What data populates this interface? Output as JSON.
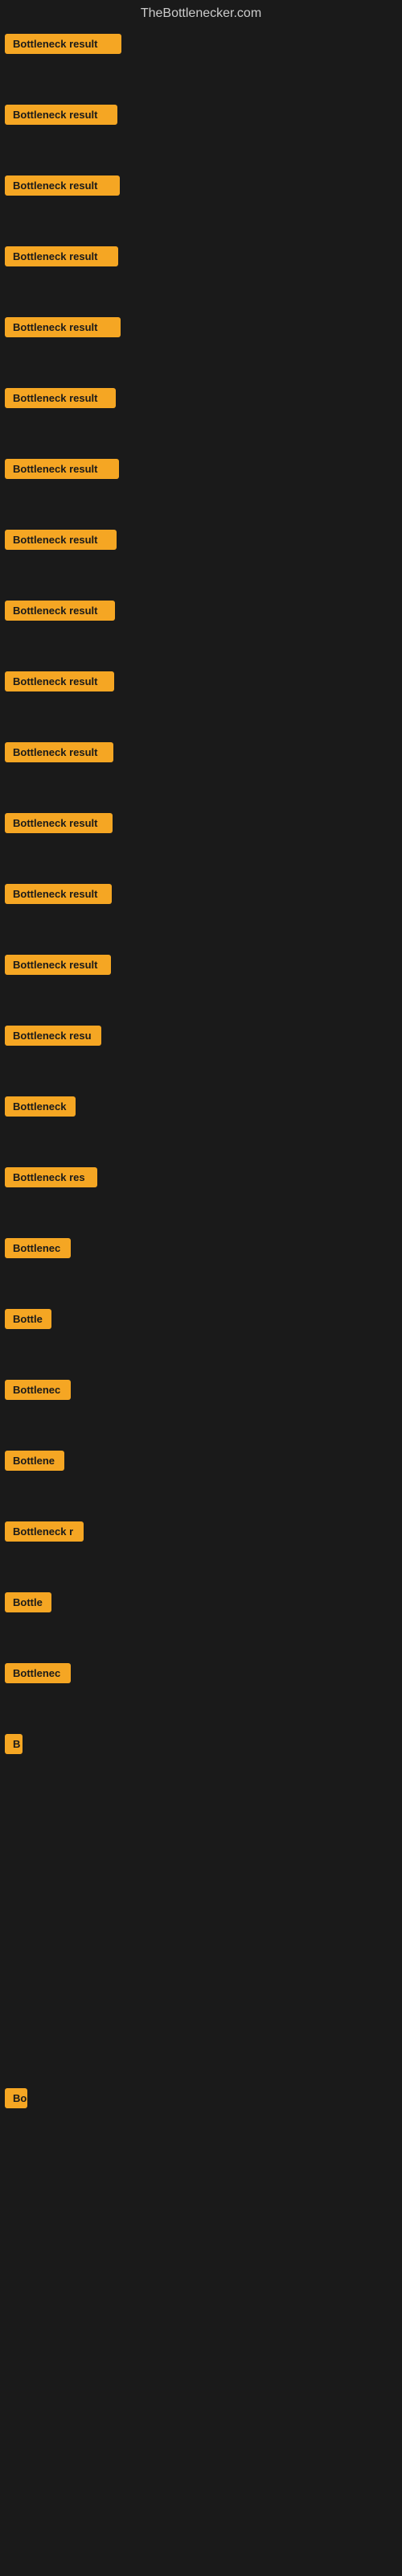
{
  "header": {
    "title": "TheBottlenecker.com"
  },
  "items": [
    {
      "label": "Bottleneck result",
      "badge_width": 145
    },
    {
      "label": "Bottleneck result",
      "badge_width": 140
    },
    {
      "label": "Bottleneck result",
      "badge_width": 143
    },
    {
      "label": "Bottleneck result",
      "badge_width": 141
    },
    {
      "label": "Bottleneck result",
      "badge_width": 144
    },
    {
      "label": "Bottleneck result",
      "badge_width": 138
    },
    {
      "label": "Bottleneck result",
      "badge_width": 142
    },
    {
      "label": "Bottleneck result",
      "badge_width": 139
    },
    {
      "label": "Bottleneck result",
      "badge_width": 137
    },
    {
      "label": "Bottleneck result",
      "badge_width": 136
    },
    {
      "label": "Bottleneck result",
      "badge_width": 135
    },
    {
      "label": "Bottleneck result",
      "badge_width": 134
    },
    {
      "label": "Bottleneck result",
      "badge_width": 133
    },
    {
      "label": "Bottleneck result",
      "badge_width": 132
    },
    {
      "label": "Bottleneck resu",
      "badge_width": 120
    },
    {
      "label": "Bottleneck",
      "badge_width": 88
    },
    {
      "label": "Bottleneck res",
      "badge_width": 115
    },
    {
      "label": "Bottlenec",
      "badge_width": 82
    },
    {
      "label": "Bottle",
      "badge_width": 58
    },
    {
      "label": "Bottlenec",
      "badge_width": 82
    },
    {
      "label": "Bottlene",
      "badge_width": 74
    },
    {
      "label": "Bottleneck r",
      "badge_width": 98
    },
    {
      "label": "Bottle",
      "badge_width": 58
    },
    {
      "label": "Bottlenec",
      "badge_width": 82
    },
    {
      "label": "B",
      "badge_width": 22
    },
    {
      "label": "",
      "badge_width": 0
    },
    {
      "label": "",
      "badge_width": 0
    },
    {
      "label": "",
      "badge_width": 0
    },
    {
      "label": "",
      "badge_width": 0
    },
    {
      "label": "Bo",
      "badge_width": 28
    },
    {
      "label": "",
      "badge_width": 0
    },
    {
      "label": "",
      "badge_width": 0
    },
    {
      "label": "",
      "badge_width": 0
    },
    {
      "label": "",
      "badge_width": 0
    },
    {
      "label": "",
      "badge_width": 0
    }
  ]
}
